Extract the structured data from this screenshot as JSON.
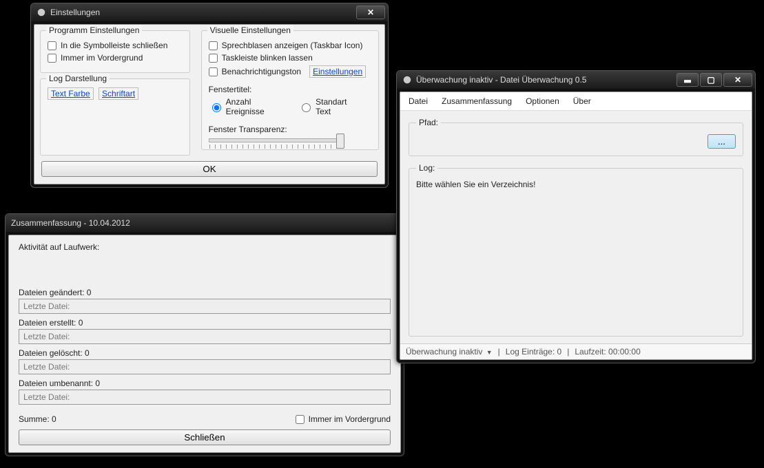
{
  "settings": {
    "title": "Einstellungen",
    "program_group": "Programm Einstellungen",
    "chk_tray": "In die Symbolleiste schließen",
    "chk_topmost": "Immer im Vordergrund",
    "log_group": "Log Darstellung",
    "link_textcolor": "Text Farbe",
    "link_font": "Schriftart",
    "visual_group": "Visuelle Einstellungen",
    "chk_balloons": "Sprechblasen anzeigen (Taskbar Icon)",
    "chk_blink": "Taskleiste blinken lassen",
    "chk_sound": "Benachrichtigungston",
    "link_settings": "Einstellungen",
    "wintitle_label": "Fenstertitel:",
    "radio_events": "Anzahl Ereignisse",
    "radio_standard": "Standart Text",
    "transparency_label": "Fenster Transparenz:",
    "ok": "OK"
  },
  "summary": {
    "title": "Zusammenfassung - 10.04.2012",
    "activity_label": "Aktivität auf Laufwerk:",
    "changed_label": "Dateien geändert: 0",
    "created_label": "Dateien erstellt: 0",
    "deleted_label": "Dateien gelöscht: 0",
    "renamed_label": "Dateien umbenannt: 0",
    "last_file": "Letzte Datei:",
    "sum_label": "Summe: 0",
    "chk_topmost": "Immer im Vordergrund",
    "close": "Schließen"
  },
  "main": {
    "title": "Überwachung inaktiv - Datei Überwachung 0.5",
    "menu": {
      "datei": "Datei",
      "zusammenfassung": "Zusammenfassung",
      "optionen": "Optionen",
      "ueber": "Über"
    },
    "path_label": "Pfad:",
    "browse": "...",
    "log_label": "Log:",
    "log_text": "Bitte wählen Sie ein Verzeichnis!",
    "status": {
      "watch": "Überwachung inaktiv",
      "entries": "Log Einträge:  0",
      "runtime": "Laufzeit: 00:00:00"
    }
  }
}
